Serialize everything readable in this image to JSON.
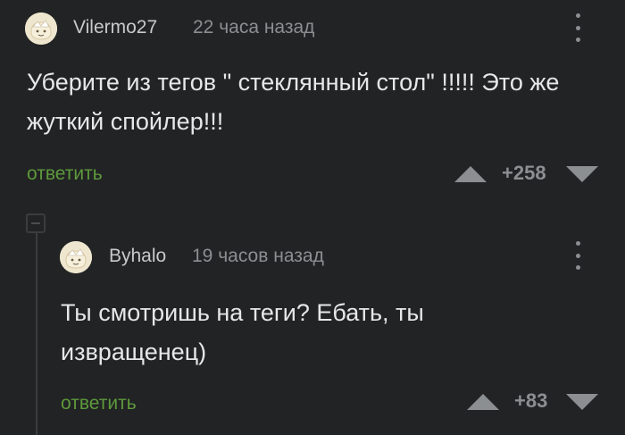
{
  "comments": [
    {
      "author": "Vilermo27",
      "time": "22 часа назад",
      "text": "Уберите из тегов \" стеклянный стол\" !!!!! Это же жуткий спойлер!!!",
      "reply_label": "ответить",
      "score": "+258"
    },
    {
      "author": "Byhalo",
      "time": "19 часов назад",
      "text": "Ты смотришь на теги? Ебать, ты извращенец)",
      "reply_label": "ответить",
      "score": "+83"
    }
  ],
  "colors": {
    "background": "#222324",
    "text": "#e6e7e8",
    "muted": "#8c8f92",
    "reply": "#5d9a3c"
  },
  "icons": {
    "avatar": "default-avatar-icon",
    "more": "more-vertical-icon",
    "upvote": "triangle-up-icon",
    "downvote": "triangle-down-icon",
    "collapse": "collapse-thread-icon"
  }
}
